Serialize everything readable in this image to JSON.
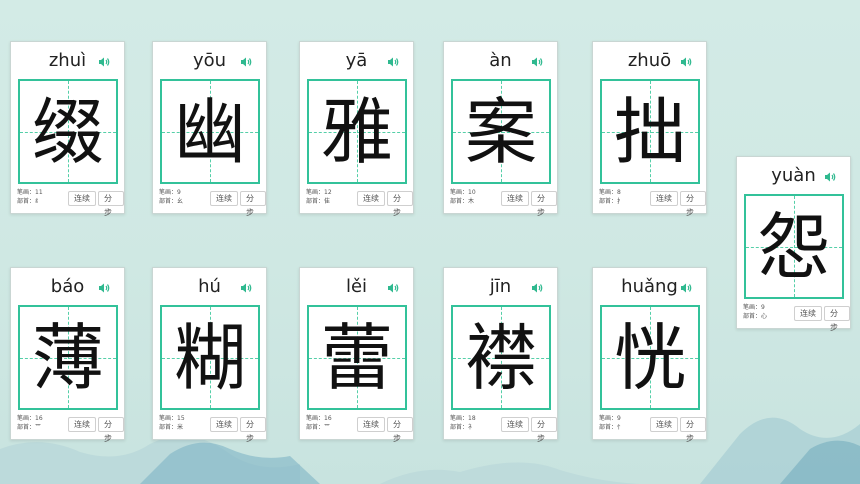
{
  "labels": {
    "strokes": "笔画：",
    "radical": "部首：",
    "continuous": "连续",
    "step": "分步"
  },
  "cards": [
    {
      "pinyin": "zhuì",
      "char": "缀",
      "strokes": "11",
      "radical": "纟"
    },
    {
      "pinyin": "yōu",
      "char": "幽",
      "strokes": "9",
      "radical": "幺"
    },
    {
      "pinyin": "yā",
      "char": "雅",
      "strokes": "12",
      "radical": "隹"
    },
    {
      "pinyin": "àn",
      "char": "案",
      "strokes": "10",
      "radical": "木"
    },
    {
      "pinyin": "zhuō",
      "char": "拙",
      "strokes": "8",
      "radical": "扌"
    },
    {
      "pinyin": "yuàn",
      "char": "怨",
      "strokes": "9",
      "radical": "心"
    },
    {
      "pinyin": "báo",
      "char": "薄",
      "strokes": "16",
      "radical": "艹"
    },
    {
      "pinyin": "hú",
      "char": "糊",
      "strokes": "15",
      "radical": "米"
    },
    {
      "pinyin": "lěi",
      "char": "蕾",
      "strokes": "16",
      "radical": "艹"
    },
    {
      "pinyin": "jīn",
      "char": "襟",
      "strokes": "18",
      "radical": "衤"
    },
    {
      "pinyin": "huǎng",
      "char": "恍",
      "strokes": "9",
      "radical": "忄"
    }
  ]
}
